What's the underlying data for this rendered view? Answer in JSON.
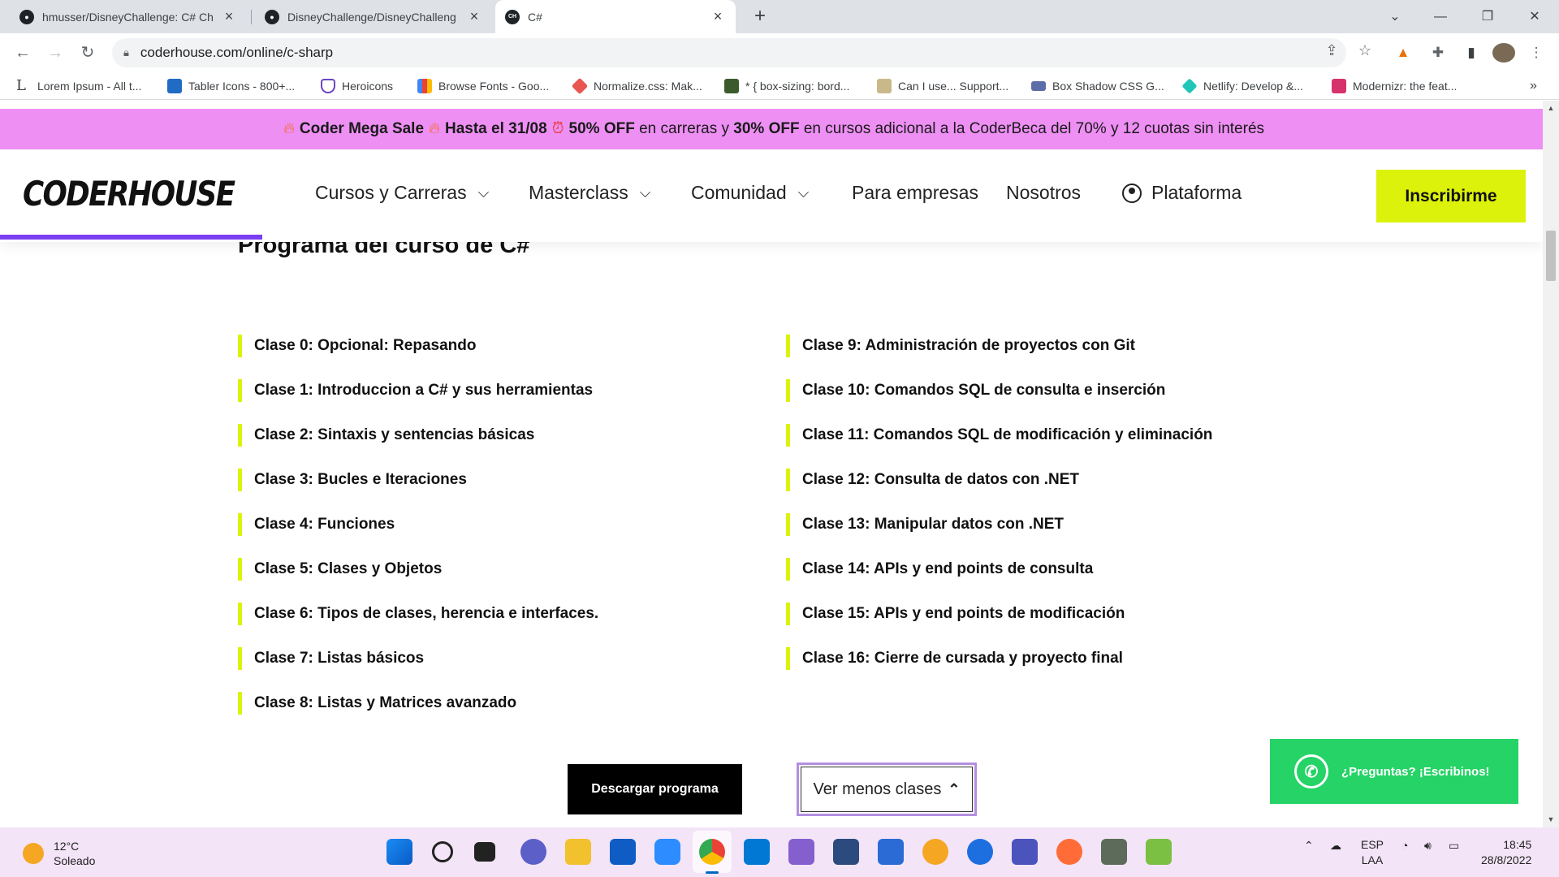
{
  "browser": {
    "tabs": [
      {
        "title": "hmusser/DisneyChallenge: C# Ch",
        "icon": "github-icon"
      },
      {
        "title": "DisneyChallenge/DisneyChalleng",
        "icon": "github-icon"
      },
      {
        "title": "C#",
        "icon": "coderhouse-icon"
      }
    ],
    "new_tab": "+",
    "url": "coderhouse.com/online/c-sharp",
    "bookmarks": [
      {
        "label": "Lorem Ipsum - All t...",
        "color": "#ffffff"
      },
      {
        "label": "Tabler Icons - 800+...",
        "color": "#206bc4"
      },
      {
        "label": "Heroicons",
        "color": "#6b46c1"
      },
      {
        "label": "Browse Fonts - Goo...",
        "color": "#4285f4"
      },
      {
        "label": "Normalize.css: Mak...",
        "color": "#e8564f"
      },
      {
        "label": "* { box-sizing: bord...",
        "color": "#3b5b2d"
      },
      {
        "label": "Can I use... Support...",
        "color": "#8c7b55"
      },
      {
        "label": "Box Shadow CSS G...",
        "color": "#5b6ea8"
      },
      {
        "label": "Netlify: Develop &...",
        "color": "#20c6b7"
      },
      {
        "label": "Modernizr: the feat...",
        "color": "#d6336c"
      }
    ],
    "more_bookmarks": "»"
  },
  "promo": {
    "part1": "Coder Mega Sale",
    "part2": "Hasta el 31/08",
    "part3": "50% OFF",
    "part4": " en carreras y ",
    "part5": "30% OFF",
    "part6": " en cursos adicional a la CoderBeca del 70% y 12 cuotas sin interés"
  },
  "site_nav": {
    "logo": "CODERHOUSE",
    "items": [
      "Cursos y Carreras",
      "Masterclass",
      "Comunidad",
      "Para empresas",
      "Nosotros",
      "Plataforma"
    ],
    "cta": "Inscribirme"
  },
  "program": {
    "title": "Programa del curso de C#",
    "left": [
      "Clase 0: Opcional: Repasando",
      "Clase 1: Introduccion a C# y sus herramientas",
      "Clase 2: Sintaxis y sentencias básicas",
      "Clase 3: Bucles e Iteraciones",
      "Clase 4: Funciones",
      "Clase 5: Clases y Objetos",
      "Clase 6: Tipos de clases, herencia e interfaces.",
      "Clase 7: Listas básicos",
      "Clase 8: Listas y Matrices avanzado"
    ],
    "right": [
      "Clase 9: Administración de proyectos con Git",
      "Clase 10: Comandos SQL de consulta e inserción",
      "Clase 11: Comandos SQL de modificación y eliminación",
      "Clase 12: Consulta de datos con .NET",
      "Clase 13: Manipular datos con .NET",
      "Clase 14: APIs y end points de consulta",
      "Clase 15: APIs y end points de modificación",
      "Clase 16: Cierre de cursada y proyecto final"
    ],
    "download_label": "Descargar programa",
    "less_label": "Ver menos clases"
  },
  "whatsapp": {
    "label": "¿Preguntas? ¡Escribinos!"
  },
  "taskbar": {
    "temp": "12°C",
    "weather": "Soleado",
    "lang1": "ESP",
    "lang2": "LAA",
    "time": "18:45",
    "date": "28/8/2022"
  },
  "colors": {
    "promo_bg": "#ee8ff4",
    "accent_yellow": "#dcf20b",
    "accent_purple": "#7b3ff2",
    "whatsapp_green": "#25d366"
  }
}
